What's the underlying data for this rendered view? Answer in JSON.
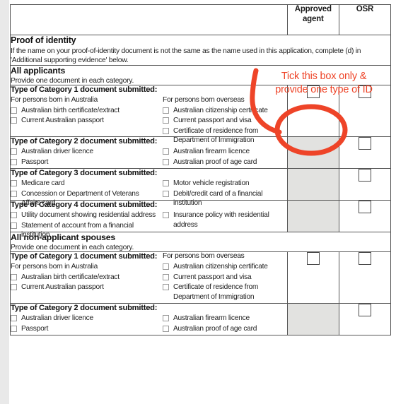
{
  "table": {
    "header": {
      "blank_label": "",
      "approved_agent": "Approved agent",
      "osr": "OSR"
    },
    "banner": {
      "title": "Proof of identity",
      "text": "If the name on your proof-of-identity document is not the same as the name used in this application, complete (d) in 'Additional supporting evidence' below."
    },
    "sections": [
      {
        "title": "All applicants",
        "subtitle": "Provide one document in each category.",
        "categories": [
          {
            "title": "Type of Category 1 document submitted:",
            "left_label": "For persons born in Australia",
            "left_options": [
              "Australian birth certificate/extract",
              "Current Australian passport"
            ],
            "right_label": "For persons born overseas",
            "right_options": [
              "Australian citizenship certificate",
              "Current passport and visa",
              "Certificate of residence from Department of Immigration"
            ],
            "agent_box": "empty",
            "osr_box": "empty"
          },
          {
            "title": "Type of Category 2 document submitted:",
            "left_label": "",
            "left_options": [
              "Australian driver licence",
              "Passport"
            ],
            "right_label": "",
            "right_options": [
              "Australian firearm licence",
              "Australian proof of age card"
            ],
            "agent_box": "shaded",
            "osr_box": "empty"
          },
          {
            "title": "Type of Category 3 document submitted:",
            "left_label": "",
            "left_options": [
              "Medicare card",
              "Concession or Department of Veterans Affairs card"
            ],
            "right_label": "",
            "right_options": [
              "Motor vehicle registration",
              "Debit/credit card of a financial institution"
            ],
            "agent_box": "shaded",
            "osr_box": "empty"
          },
          {
            "title": "Type of Category 4 document submitted:",
            "left_label": "",
            "left_options": [
              "Utility document showing residential address",
              "Statement of account from a financial institution"
            ],
            "right_label": "",
            "right_options": [
              "Insurance policy with residential address"
            ],
            "agent_box": "shaded",
            "osr_box": "empty"
          }
        ]
      },
      {
        "title": "All non-applicant spouses",
        "subtitle": "Provide one document in each category.",
        "categories": [
          {
            "title": "Type of Category 1 document submitted:",
            "left_label": "For persons born in Australia",
            "left_options": [
              "Australian birth certificate/extract",
              "Current Australian passport"
            ],
            "right_label": "For persons born overseas",
            "right_options": [
              "Australian citizenship certificate",
              "Current passport and visa",
              "Certificate of residence from Department of Immigration"
            ],
            "agent_box": "empty",
            "osr_box": "empty",
            "right_label_raised": true
          },
          {
            "title": "Type of Category 2 document submitted:",
            "left_label": "",
            "left_options": [
              "Australian driver licence",
              "Passport"
            ],
            "right_label": "",
            "right_options": [
              "Australian firearm licence",
              "Australian proof of age card"
            ],
            "agent_box": "shaded",
            "osr_box": "empty"
          }
        ]
      }
    ]
  },
  "annotation": {
    "line1": "Tick this box only &",
    "line2": "provide one type of ID",
    "color": "#ee4428",
    "shape": "ellipse-with-arrow"
  }
}
